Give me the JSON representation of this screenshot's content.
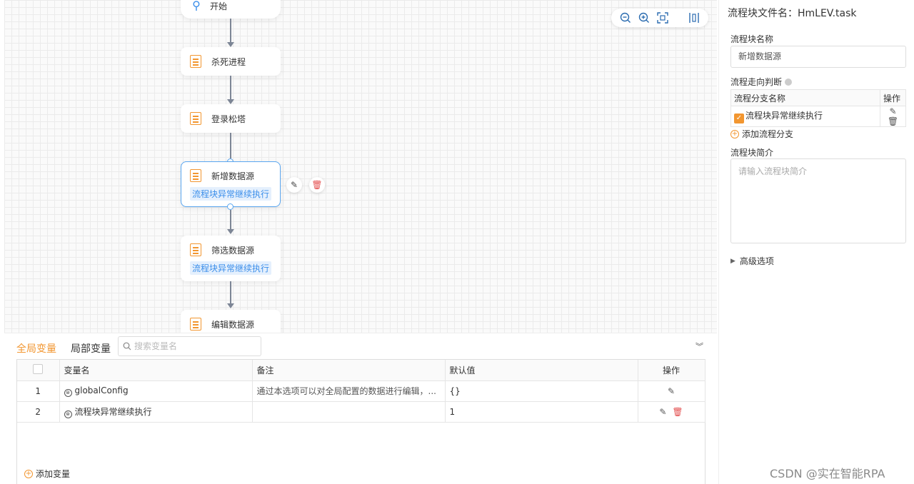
{
  "flow": {
    "start_label": "开始",
    "nodes": [
      {
        "label": "杀死进程",
        "tag": ""
      },
      {
        "label": "登录松塔",
        "tag": ""
      },
      {
        "label": "新增数据源",
        "tag": "流程块异常继续执行"
      },
      {
        "label": "筛选数据源",
        "tag": "流程块异常继续执行"
      },
      {
        "label": "编辑数据源",
        "tag": ""
      }
    ]
  },
  "right_panel": {
    "file_title": "流程块文件名：HmLEV.task",
    "block_name_label": "流程块名称",
    "block_name_value": "新增数据源",
    "branch_label": "流程走向判断",
    "branch_table": {
      "col_name": "流程分支名称",
      "col_op": "操作",
      "rows": [
        {
          "name": "流程块异常继续执行"
        }
      ]
    },
    "add_branch": "添加流程分支",
    "intro_label": "流程块简介",
    "intro_placeholder": "请输入流程块简介",
    "advanced": "高级选项"
  },
  "bottom_panel": {
    "tab_global": "全局变量",
    "tab_local": "局部变量",
    "search_placeholder": "搜索变量名",
    "columns": [
      "变量名",
      "备注",
      "默认值",
      "操作"
    ],
    "rows": [
      {
        "index": "1",
        "name": "globalConfig",
        "note": "通过本选项可以对全局配置的数据进行编辑，...",
        "default": "{}"
      },
      {
        "index": "2",
        "name": "流程块异常继续执行",
        "note": "",
        "default": "1"
      }
    ],
    "add_var": "添加变量"
  },
  "watermark": "CSDN @实在智能RPA"
}
